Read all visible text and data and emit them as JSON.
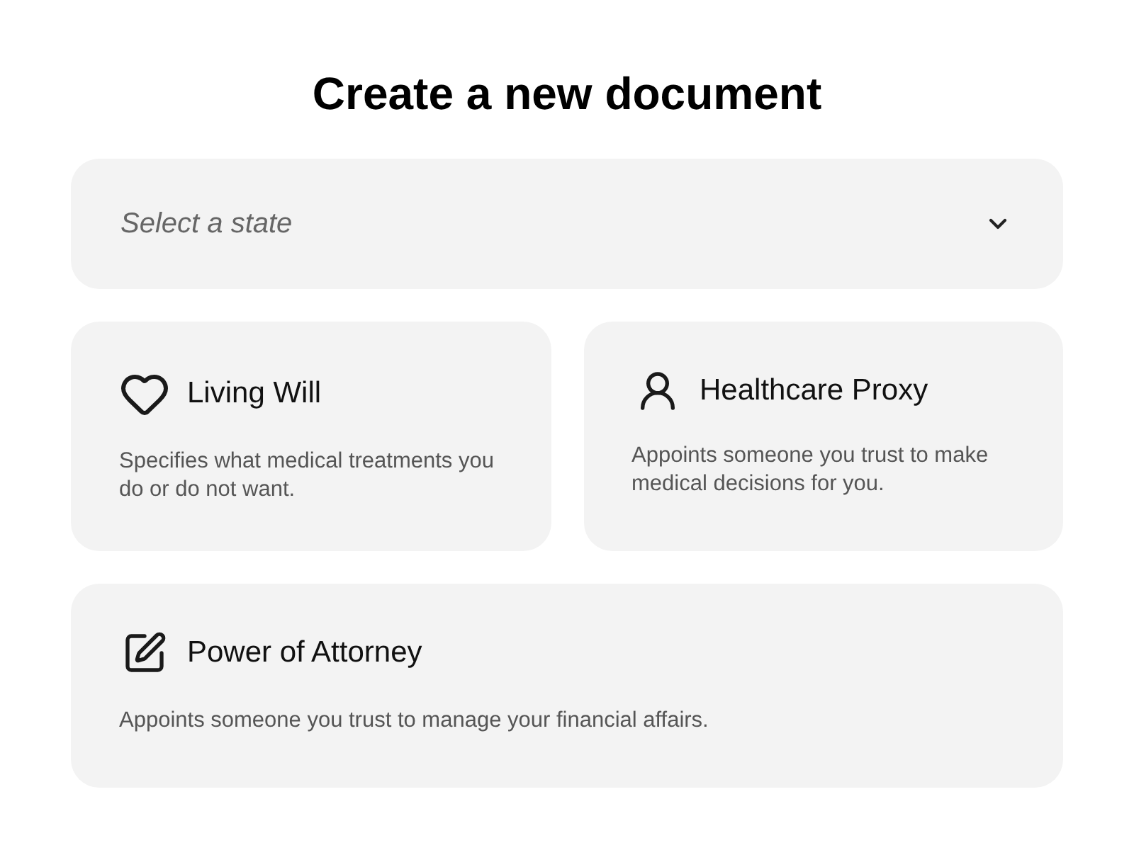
{
  "title": "Create a new document",
  "state_select": {
    "placeholder": "Select a state"
  },
  "documents": [
    {
      "kind": "heart",
      "title": "Living Will",
      "description": "Specifies what medical treatments you do or do not want.",
      "wide": false
    },
    {
      "kind": "person",
      "title": "Healthcare Proxy",
      "description": "Appoints someone you trust to make medical decisions for you.",
      "wide": false
    },
    {
      "kind": "edit",
      "title": "Power of Attorney",
      "description": "Appoints someone you trust to manage your financial affairs.",
      "wide": true
    }
  ]
}
